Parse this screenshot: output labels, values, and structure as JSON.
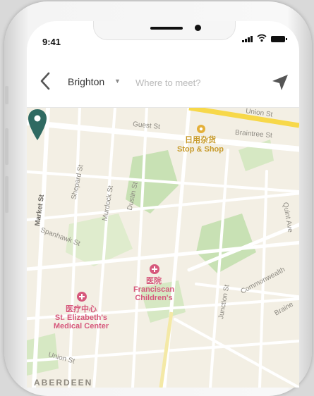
{
  "status": {
    "time": "9:41"
  },
  "search": {
    "city": "Brighton",
    "placeholder": "Where to meet?"
  },
  "map": {
    "streets": {
      "union_top": "Union St",
      "guest": "Guest St",
      "braintree": "Braintree St",
      "market": "Market St",
      "shepard": "Shepard St",
      "murdock": "Murdock St",
      "dustin": "Dustin St",
      "spanhawk": "Spanhawk St",
      "quint": "Quint Ave",
      "commonwealth": "Commonwealth",
      "junction": "Junction St",
      "union_bottom": "Union St",
      "brainerd": "Braine"
    },
    "shop": {
      "name_zh": "日用杂货",
      "name_en": "Stop & Shop"
    },
    "hospital": {
      "name_zh": "医院",
      "name_en_1": "Franciscan",
      "name_en_2": "Children's"
    },
    "medical_center": {
      "name_zh": "医疗中心",
      "name_en_1": "St. Elizabeth's",
      "name_en_2": "Medical Center"
    },
    "district": "ABERDEEN"
  },
  "colors": {
    "park": "#c8e1b4",
    "road": "#ffffff",
    "highway": "#f7d84a",
    "pin": "#2f6a62",
    "medical": "#d6587c",
    "shop": "#e4b03a"
  }
}
